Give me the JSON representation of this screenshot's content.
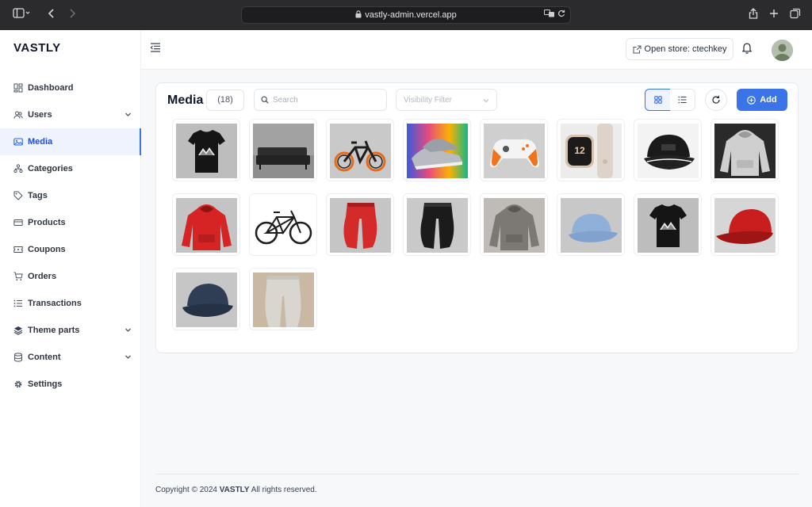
{
  "browser": {
    "url": "vastly-admin.vercel.app"
  },
  "sidebar": {
    "brand": "VASTLY",
    "items": [
      {
        "label": "Dashboard",
        "icon": "dashboard-icon",
        "expandable": false,
        "active": false
      },
      {
        "label": "Users",
        "icon": "users-icon",
        "expandable": true,
        "active": false
      },
      {
        "label": "Media",
        "icon": "media-icon",
        "expandable": false,
        "active": true
      },
      {
        "label": "Categories",
        "icon": "categories-icon",
        "expandable": false,
        "active": false
      },
      {
        "label": "Tags",
        "icon": "tag-icon",
        "expandable": false,
        "active": false
      },
      {
        "label": "Products",
        "icon": "products-icon",
        "expandable": false,
        "active": false
      },
      {
        "label": "Coupons",
        "icon": "coupon-icon",
        "expandable": false,
        "active": false
      },
      {
        "label": "Orders",
        "icon": "cart-icon",
        "expandable": false,
        "active": false
      },
      {
        "label": "Transactions",
        "icon": "list-icon",
        "expandable": false,
        "active": false
      },
      {
        "label": "Theme parts",
        "icon": "layers-icon",
        "expandable": true,
        "active": false
      },
      {
        "label": "Content",
        "icon": "database-icon",
        "expandable": true,
        "active": false
      },
      {
        "label": "Settings",
        "icon": "gear-icon",
        "expandable": false,
        "active": false
      }
    ]
  },
  "header": {
    "store_button": "Open store: ctechkey"
  },
  "media": {
    "title": "Media",
    "count": "(18)",
    "search_placeholder": "Search",
    "visibility_placeholder": "Visibility Filter",
    "add_label": "Add",
    "items": [
      {
        "subject": "black-tshirt"
      },
      {
        "subject": "sofa"
      },
      {
        "subject": "ebike"
      },
      {
        "subject": "sneakers"
      },
      {
        "subject": "game-controller"
      },
      {
        "subject": "smartwatch"
      },
      {
        "subject": "black-cap"
      },
      {
        "subject": "grey-hoodie"
      },
      {
        "subject": "red-hoodie"
      },
      {
        "subject": "bicycle"
      },
      {
        "subject": "red-joggers"
      },
      {
        "subject": "black-joggers"
      },
      {
        "subject": "grey-hoodie"
      },
      {
        "subject": "blue-cap"
      },
      {
        "subject": "black-tshirt"
      },
      {
        "subject": "red-cap"
      },
      {
        "subject": "navy-cap"
      },
      {
        "subject": "beige-pants"
      }
    ]
  },
  "colors": {
    "accent": "#3b73e8",
    "active_bg": "#eef3fd"
  },
  "footer": {
    "prefix": "Copyright © 2024",
    "brand": "VASTLY",
    "suffix": "All rights reserved."
  }
}
